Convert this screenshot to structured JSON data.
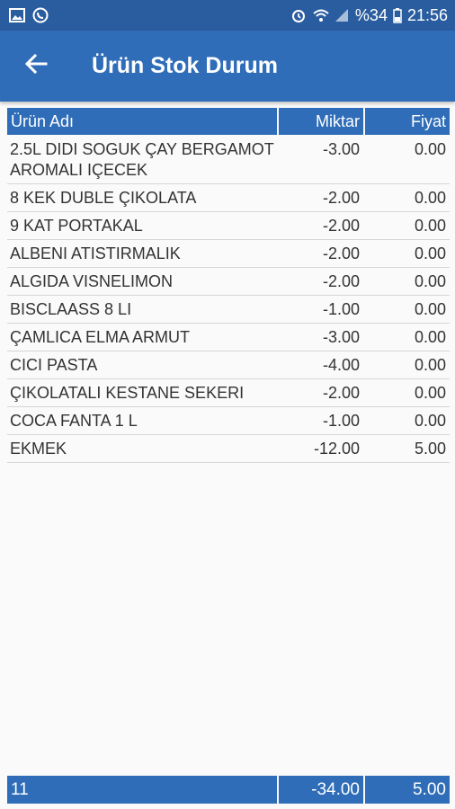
{
  "status_bar": {
    "left_icons": [
      "gallery-icon",
      "whatsapp-icon"
    ],
    "right_icons": [
      "alarm-icon",
      "wifi-icon",
      "signal-icon",
      "battery-icon"
    ],
    "battery": "%34",
    "time": "21:56"
  },
  "app_bar": {
    "back_icon": "arrow-left-icon",
    "title": "Ürün Stok Durum"
  },
  "table": {
    "headers": {
      "name": "Ürün Adı",
      "quantity": "Miktar",
      "price": "Fiyat"
    },
    "rows": [
      {
        "name": "2.5L DIDI SOGUK ÇAY BERGAMOT AROMALI IÇECEK",
        "quantity": "-3.00",
        "price": "0.00"
      },
      {
        "name": "8 KEK DUBLE ÇIKOLATA",
        "quantity": "-2.00",
        "price": "0.00"
      },
      {
        "name": "9 KAT PORTAKAL",
        "quantity": "-2.00",
        "price": "0.00"
      },
      {
        "name": "ALBENI ATISTIRMALIK",
        "quantity": "-2.00",
        "price": "0.00"
      },
      {
        "name": "ALGIDA VISNELIMON",
        "quantity": "-2.00",
        "price": "0.00"
      },
      {
        "name": "BISCLAASS 8 LI",
        "quantity": "-1.00",
        "price": "0.00"
      },
      {
        "name": "ÇAMLICA ELMA ARMUT",
        "quantity": "-3.00",
        "price": "0.00"
      },
      {
        "name": "CICI PASTA",
        "quantity": "-4.00",
        "price": "0.00"
      },
      {
        "name": "ÇIKOLATALI KESTANE SEKERI",
        "quantity": "-2.00",
        "price": "0.00"
      },
      {
        "name": "COCA FANTA 1 L",
        "quantity": "-1.00",
        "price": "0.00"
      },
      {
        "name": "EKMEK",
        "quantity": "-12.00",
        "price": "5.00"
      }
    ],
    "footer": {
      "count": "11",
      "quantity_total": "-34.00",
      "price_total": "5.00"
    }
  },
  "colors": {
    "status_bar": "#2a5d9f",
    "app_bar": "#2f6db8",
    "header": "#2f6db8",
    "background": "#fafafa"
  }
}
